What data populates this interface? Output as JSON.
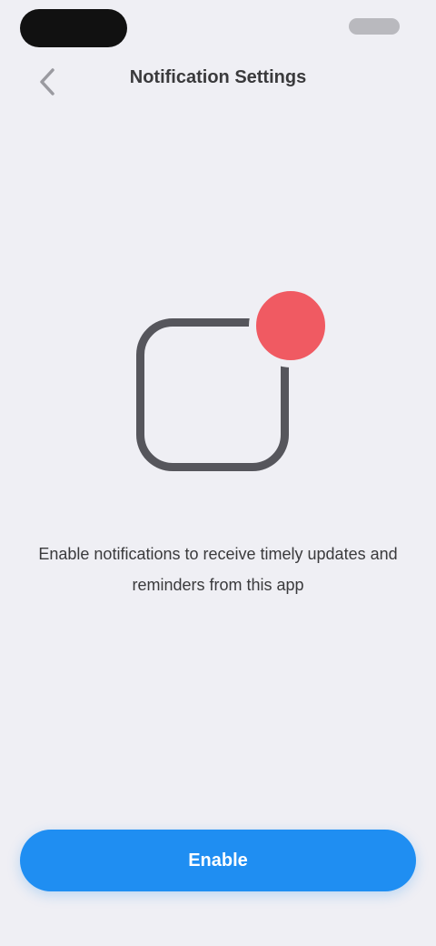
{
  "status_bar": {
    "time_icon": "time-pill",
    "indicators_icon": "battery-icon"
  },
  "nav": {
    "back_icon": "chevron-left-icon",
    "title": "Notification Settings"
  },
  "illustration": {
    "app_icon": "app-square-icon",
    "badge_icon": "notification-badge-icon",
    "badge_color": "#f05a62",
    "outline_color": "#56565c"
  },
  "description": {
    "text": "Enable notifications to receive timely updates and reminders from this app"
  },
  "primary_button": {
    "label": "Enable",
    "color": "#1f8ef2"
  }
}
